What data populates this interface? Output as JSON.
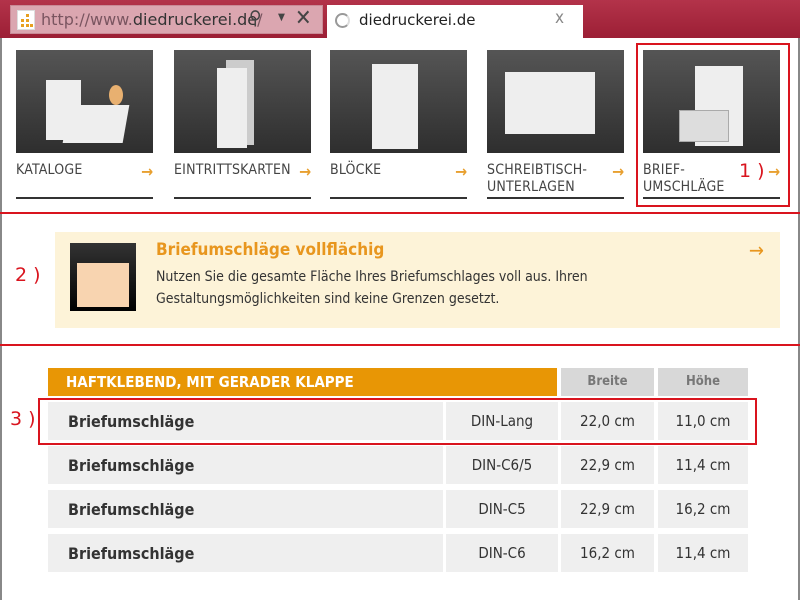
{
  "browser": {
    "url_prefix": "http://www.",
    "url_domain": "diedruckerei.de",
    "url_suffix": "/",
    "tab_title": "diedruckerei.de",
    "tab_close": "x",
    "search_icon": "search-icon",
    "stop_icon": "close-icon"
  },
  "categories": [
    {
      "label": "KATALOGE",
      "arrow": "→"
    },
    {
      "label": "EINTRITTSKARTEN",
      "arrow": "→"
    },
    {
      "label": "BLÖCKE",
      "arrow": "→"
    },
    {
      "label": "SCHREIBTISCH-\nUNTERLAGEN",
      "arrow": "→"
    },
    {
      "label": "BRIEF-\nUMSCHLÄGE",
      "arrow": "→"
    }
  ],
  "annotations": {
    "one": "1 )",
    "two": "2 )",
    "three": "3 )",
    "color": "#d9141e"
  },
  "banner": {
    "title": "Briefumschläge vollflächig",
    "text": "Nutzen Sie die gesamte Fläche Ihres Briefumschlages voll aus. Ihren Gestaltungsmöglichkeiten sind keine Grenzen gesetzt.",
    "arrow": "→"
  },
  "table": {
    "title": "HAFTKLEBEND, MIT GERADER KLAPPE",
    "columns": [
      "Breite",
      "Höhe"
    ],
    "rows": [
      {
        "name": "Briefumschläge",
        "format": "DIN-Lang",
        "breite": "22,0 cm",
        "hoehe": "11,0 cm"
      },
      {
        "name": "Briefumschläge",
        "format": "DIN-C6/5",
        "breite": "22,9 cm",
        "hoehe": "11,4 cm"
      },
      {
        "name": "Briefumschläge",
        "format": "DIN-C5",
        "breite": "22,9 cm",
        "hoehe": "16,2 cm"
      },
      {
        "name": "Briefumschläge",
        "format": "DIN-C6",
        "breite": "16,2 cm",
        "hoehe": "11,4 cm"
      }
    ]
  },
  "colors": {
    "accent": "#e89605",
    "browser_bar": "#a8263c"
  }
}
